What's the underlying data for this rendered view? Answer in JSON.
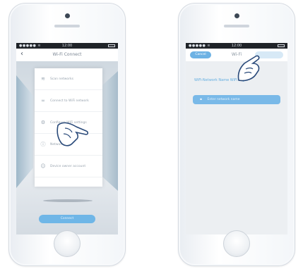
{
  "left_phone": {
    "status": {
      "signal": "●●●●● ≋",
      "time": "12:00"
    },
    "nav_back_icon": "back-arrow-icon",
    "nav_title": "Wi-Fi Connect",
    "menu_items": [
      {
        "icon": "wifi-icon",
        "label": "Scan networks"
      },
      {
        "icon": "link-icon",
        "label": "Connect to WiFi network"
      },
      {
        "icon": "gear-icon",
        "label": "Configure WiFi settings"
      },
      {
        "icon": "info-icon",
        "label": "Network info"
      },
      {
        "icon": "user-icon",
        "label": "Device owner account"
      }
    ],
    "bottom_button": "Connect"
  },
  "right_phone": {
    "status": {
      "signal": "●●●●● ≋",
      "time": "12:00"
    },
    "tab_label": "Cancel",
    "nav_title": "Wi-Fi",
    "heading": "WiFi-Network Name WiFi Login",
    "input_label": "Enter network name"
  },
  "colors": {
    "accent": "#6db2e4",
    "heading": "#63aee0"
  }
}
